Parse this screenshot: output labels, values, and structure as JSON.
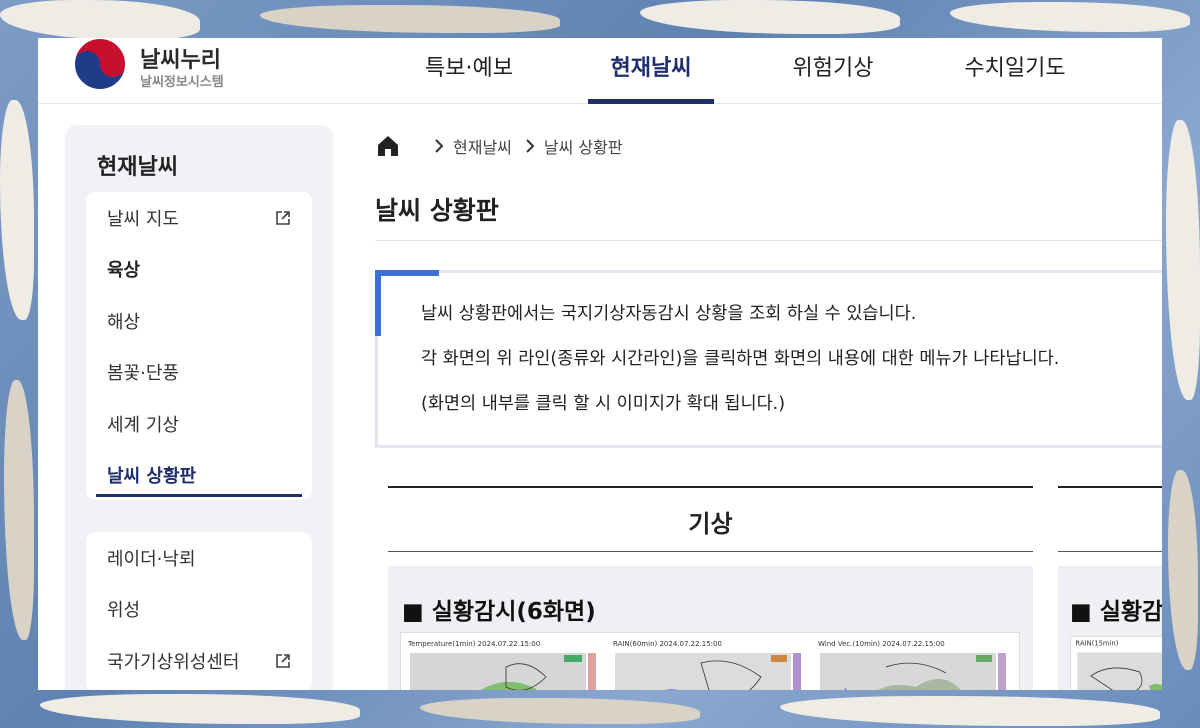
{
  "brand": {
    "title": "날씨누리",
    "subtitle": "날씨정보시스템",
    "logo_icon": "taegeuk-emblem-icon"
  },
  "gnb": [
    {
      "label": "특보·예보",
      "active": false
    },
    {
      "label": "현재날씨",
      "active": true
    },
    {
      "label": "위험기상",
      "active": false
    },
    {
      "label": "수치일기도",
      "active": false
    }
  ],
  "sidebar": {
    "title": "현재날씨",
    "group1": [
      {
        "label": "날씨 지도",
        "external": true
      },
      {
        "label": "육상",
        "bold": true
      },
      {
        "label": "해상"
      },
      {
        "label": "봄꽃·단풍"
      },
      {
        "label": "세계 기상"
      },
      {
        "label": "날씨 상황판",
        "current": true
      }
    ],
    "group2": [
      {
        "label": "레이더·낙뢰"
      },
      {
        "label": "위성"
      },
      {
        "label": "국가기상위성센터",
        "external": true
      }
    ]
  },
  "breadcrumb": {
    "home_icon": "home-icon",
    "items": [
      "현재날씨",
      "날씨 상황판"
    ]
  },
  "page_title": "날씨 상황판",
  "notice": {
    "lines": [
      "날씨 상황판에서는 국지기상자동감시 상황을 조회 하실 수 있습니다.",
      "각 화면의 위 라인(종류와 시간라인)을 클릭하면 화면의 내용에 대한 메뉴가 나타납니다.",
      "(화면의 내부를 클릭 할 시 이미지가 확대 됩니다.)"
    ]
  },
  "section": {
    "heading": "기상",
    "card_title": "■ 실황감시(6화면)",
    "thumbs": [
      {
        "header": "Temperature(1min)  2024.07.22.15:00"
      },
      {
        "header": "RAIN(60min)  2024.07.22.15:00"
      },
      {
        "header": "Wind Vec.(10min)  2024.07.22.15:00"
      }
    ]
  },
  "section2": {
    "card_title": "■ 실황감",
    "thumb_header": "RAIN(15min)"
  },
  "colors": {
    "accent": "#1f2e6e",
    "notice_accent": "#3c6fd8",
    "sidebar_bg": "#f0f2f6"
  }
}
